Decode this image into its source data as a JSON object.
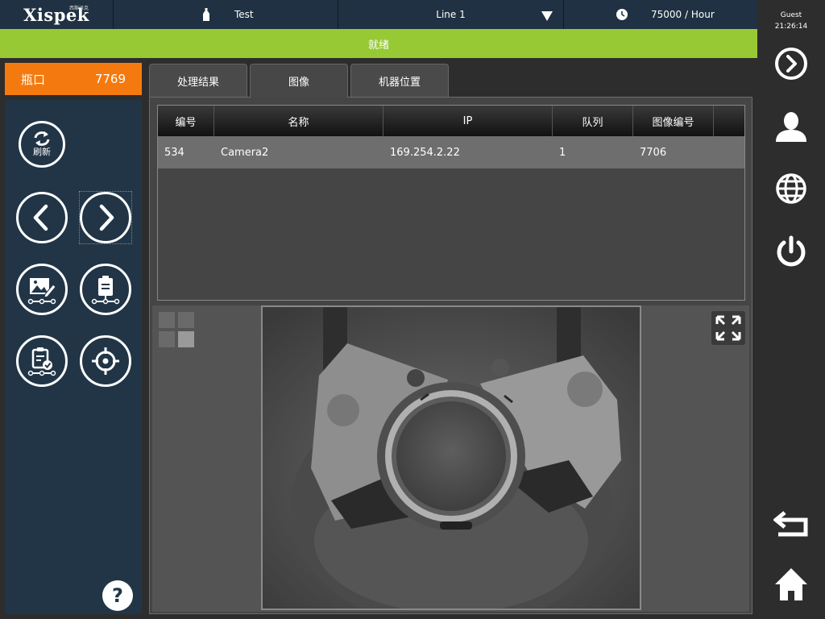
{
  "header": {
    "logo": "Xispek",
    "logo_sub": "西斯派克",
    "product": "Test",
    "line": "Line 1",
    "speed": "75000 / Hour"
  },
  "status": "就绪",
  "rail": {
    "user": "Guest",
    "time": "21:26:14"
  },
  "shift": {
    "label": "瓶口",
    "count": "7769"
  },
  "left": {
    "refresh_label": "刷新",
    "help": "?"
  },
  "tabs": [
    "处理结果",
    "图像",
    "机器位置"
  ],
  "table": {
    "headers": [
      "编号",
      "名称",
      "IP",
      "队列",
      "图像编号"
    ],
    "rows": [
      [
        "534",
        "Camera2",
        "169.254.2.22",
        "1",
        "7706"
      ]
    ]
  },
  "colors": {
    "status_green": "#97c934",
    "shift_orange": "#f47a0f",
    "panel_navy": "#213547",
    "header_navy": "#1f3142"
  }
}
